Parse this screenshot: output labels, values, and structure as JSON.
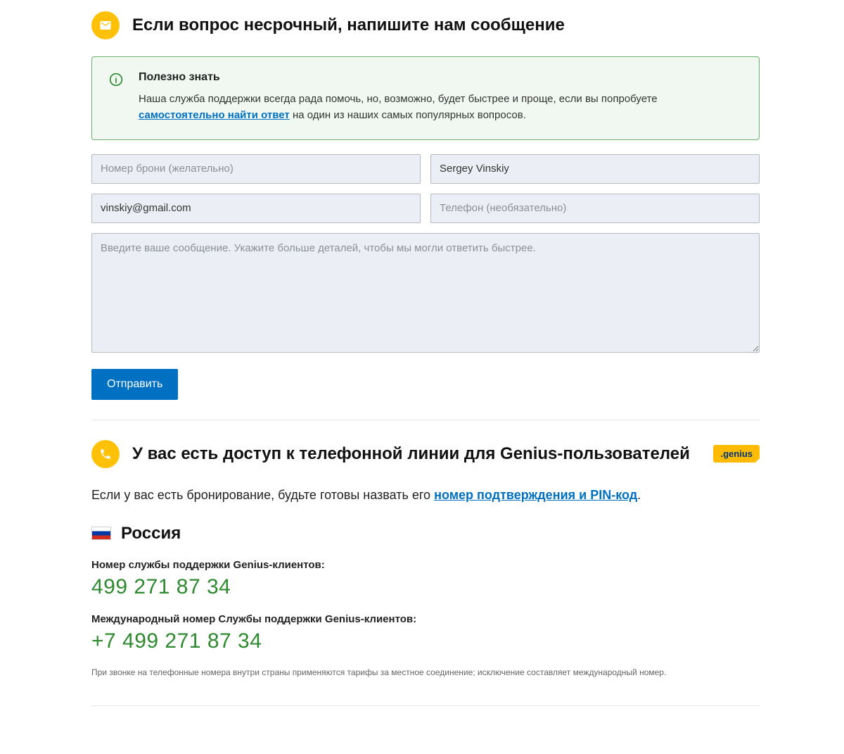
{
  "messageSection": {
    "heading": "Если вопрос несрочный, напишите нам сообщение",
    "infoBox": {
      "title": "Полезно знать",
      "textBefore": "Наша служба поддержки всегда рада помочь, но, возможно, будет быстрее и проще, если вы попробуете ",
      "linkText": "самостоятельно найти ответ",
      "textAfter": " на один из наших самых популярных вопросов."
    },
    "form": {
      "bookingPlaceholder": "Номер брони (желательно)",
      "nameValue": "Sergey Vinskiy",
      "emailValue": "vinskiy@gmail.com",
      "phonePlaceholder": "Телефон (необязательно)",
      "messagePlaceholder": "Введите ваше сообщение. Укажите больше деталей, чтобы мы могли ответить быстрее.",
      "submitLabel": "Отправить"
    }
  },
  "phoneSection": {
    "heading": "У вас есть доступ к телефонной линии для Genius-пользователей",
    "badge": ".genius",
    "leadBefore": "Если у вас есть бронирование, будьте готовы назвать его ",
    "leadLink": "номер подтверждения и PIN-код",
    "leadAfter": ".",
    "country": "Россия",
    "domesticLabel": "Номер службы поддержки Genius-клиентов:",
    "domesticNumber": "499 271 87 34",
    "intlLabel": "Международный номер Службы поддержки Genius-клиентов:",
    "intlNumber": "+7 499 271 87 34",
    "disclaimer": "При звонке на телефонные номера внутри страны применяются тарифы за местное соединение; исключение составляет международный номер."
  }
}
